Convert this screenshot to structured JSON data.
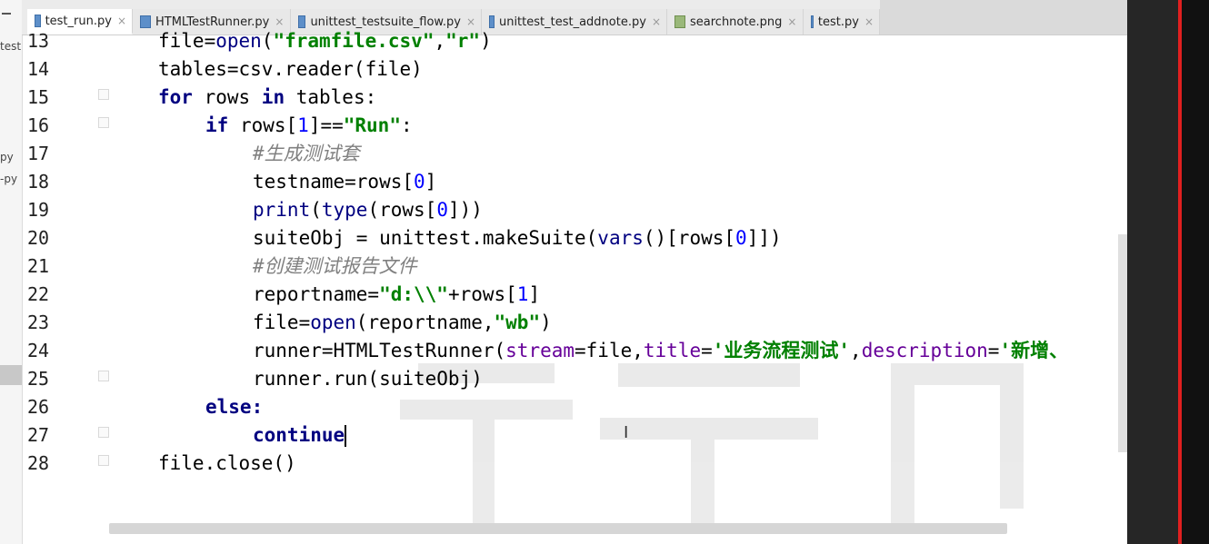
{
  "tabs": [
    {
      "label": "test_run.py",
      "active": true,
      "icon": "python-file-icon"
    },
    {
      "label": "HTMLTestRunner.py",
      "active": false,
      "icon": "python-file-icon"
    },
    {
      "label": "unittest_testsuite_flow.py",
      "active": false,
      "icon": "python-file-icon"
    },
    {
      "label": "unittest_test_addnote.py",
      "active": false,
      "icon": "python-file-icon"
    },
    {
      "label": "searchnote.png",
      "active": false,
      "icon": "image-file-icon"
    },
    {
      "label": "test.py",
      "active": false,
      "icon": "python-file-icon"
    }
  ],
  "tab_close_glyph": "×",
  "left_panel": {
    "labels": [
      "test",
      "py",
      "-py"
    ]
  },
  "editor": {
    "lines": [
      {
        "num": "13",
        "text": "file=open(\"framfile.csv\",\"r\")"
      },
      {
        "num": "14",
        "text": "tables=csv.reader(file)"
      },
      {
        "num": "15",
        "text": "for rows in tables:"
      },
      {
        "num": "16",
        "text": "if rows[1]==\"Run\":"
      },
      {
        "num": "17",
        "text": "#生成测试套"
      },
      {
        "num": "18",
        "text": "testname=rows[0]"
      },
      {
        "num": "19",
        "text": "print(type(rows[0]))"
      },
      {
        "num": "20",
        "text": "suiteObj = unittest.makeSuite(vars()[rows[0]])"
      },
      {
        "num": "21",
        "text": "#创建测试报告文件"
      },
      {
        "num": "22",
        "text": "reportname=\"d:\\\\\"+rows[1]"
      },
      {
        "num": "23",
        "text": "file=open(reportname,\"wb\")"
      },
      {
        "num": "24",
        "text": "runner=HTMLTestRunner(stream=file,title='业务流程测试',description='新增、"
      },
      {
        "num": "25",
        "text": "runner.run(suiteObj)"
      },
      {
        "num": "26",
        "text": "else:"
      },
      {
        "num": "27",
        "text": "continue"
      },
      {
        "num": "28",
        "text": "file.close()"
      }
    ]
  },
  "colors": {
    "keyword": "#000080",
    "string": "#008000",
    "number": "#0000ff",
    "comment": "#808080",
    "param": "#660099",
    "right_edge": "#e02020"
  }
}
